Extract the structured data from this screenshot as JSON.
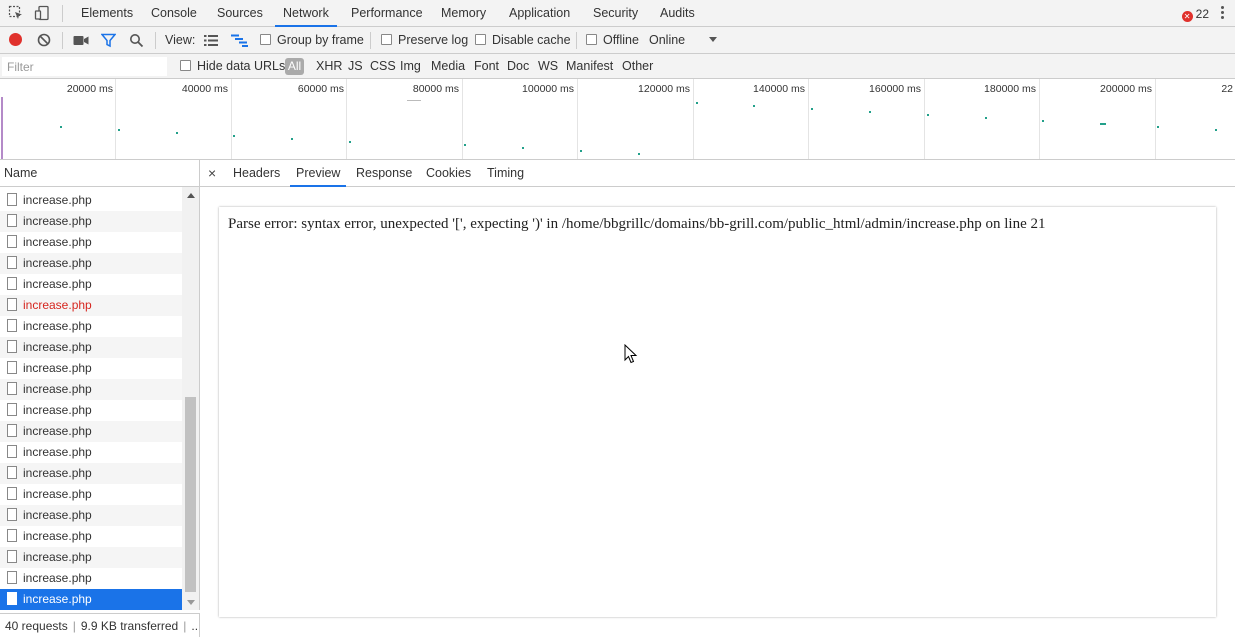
{
  "main_tabs": [
    {
      "label": "Elements"
    },
    {
      "label": "Console"
    },
    {
      "label": "Sources"
    },
    {
      "label": "Network",
      "active": true
    },
    {
      "label": "Performance"
    },
    {
      "label": "Memory"
    },
    {
      "label": "Application"
    },
    {
      "label": "Security"
    },
    {
      "label": "Audits"
    }
  ],
  "error_count": "22",
  "toolbar": {
    "view_label": "View:",
    "group_by_frame": "Group by frame",
    "preserve_log": "Preserve log",
    "disable_cache": "Disable cache",
    "offline": "Offline",
    "throttle_value": "Online"
  },
  "filterbar": {
    "filter_placeholder": "Filter",
    "hide_data_urls": "Hide data URLs",
    "types": [
      "All",
      "XHR",
      "JS",
      "CSS",
      "Img",
      "Media",
      "Font",
      "Doc",
      "WS",
      "Manifest",
      "Other"
    ]
  },
  "overview": {
    "ticks": [
      "20000 ms",
      "40000 ms",
      "60000 ms",
      "80000 ms",
      "100000 ms",
      "120000 ms",
      "140000 ms",
      "160000 ms",
      "180000 ms",
      "200000 ms",
      "22"
    ]
  },
  "colors": {
    "accent": "#1a73e8",
    "record": "#e0312c",
    "error_text": "#d6261f",
    "timeline_dot": "#22a08a"
  },
  "list": {
    "header": "Name",
    "rows": [
      {
        "name": "increase.php"
      },
      {
        "name": "increase.php"
      },
      {
        "name": "increase.php"
      },
      {
        "name": "increase.php"
      },
      {
        "name": "increase.php"
      },
      {
        "name": "increase.php",
        "error": true
      },
      {
        "name": "increase.php"
      },
      {
        "name": "increase.php"
      },
      {
        "name": "increase.php"
      },
      {
        "name": "increase.php"
      },
      {
        "name": "increase.php"
      },
      {
        "name": "increase.php"
      },
      {
        "name": "increase.php"
      },
      {
        "name": "increase.php"
      },
      {
        "name": "increase.php"
      },
      {
        "name": "increase.php"
      },
      {
        "name": "increase.php"
      },
      {
        "name": "increase.php"
      },
      {
        "name": "increase.php"
      },
      {
        "name": "increase.php",
        "selected": true
      }
    ]
  },
  "status": {
    "requests": "40 requests",
    "transferred": "9.9 KB transferred",
    "more": "..."
  },
  "detail": {
    "close": "×",
    "tabs": [
      {
        "label": "Headers"
      },
      {
        "label": "Preview",
        "active": true
      },
      {
        "label": "Response"
      },
      {
        "label": "Cookies"
      },
      {
        "label": "Timing"
      }
    ],
    "preview_text": "Parse error: syntax error, unexpected '[', expecting ')' in /home/bbgrillc/domains/bb-grill.com/public_html/admin/increase.php on line 21"
  }
}
